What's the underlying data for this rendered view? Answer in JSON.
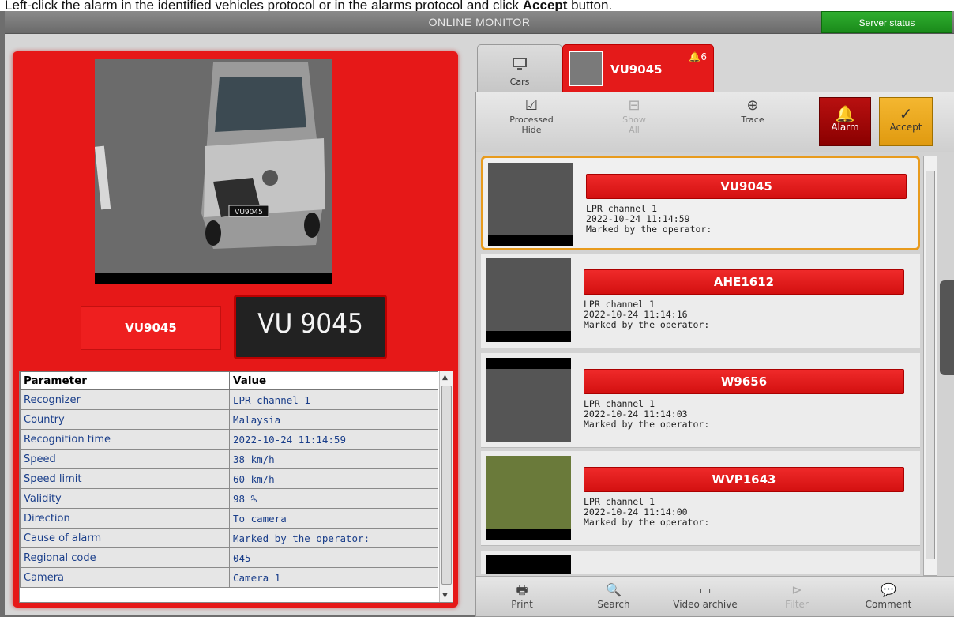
{
  "instruction": {
    "prefix": "Left-click the alarm in the identified vehicles protocol or in the alarms protocol and click ",
    "bold": "Accept",
    "suffix": " button."
  },
  "window": {
    "title": "ONLINE MONITOR",
    "server_status": "Server status"
  },
  "alarm": {
    "plate_text": "VU9045",
    "plate_image_text": "VU 9045",
    "photo_plate_text": "VU9045"
  },
  "params": {
    "col_param": "Parameter",
    "col_value": "Value",
    "rows": [
      {
        "k": "Recognizer",
        "v": "LPR channel  1"
      },
      {
        "k": "Country",
        "v": "Malaysia"
      },
      {
        "k": "Recognition time",
        "v": "2022-10-24 11:14:59"
      },
      {
        "k": "Speed",
        "v": "38 km/h"
      },
      {
        "k": "Speed limit",
        "v": "60 km/h"
      },
      {
        "k": "Validity",
        "v": "98 %"
      },
      {
        "k": "Direction",
        "v": "To camera"
      },
      {
        "k": "Cause of alarm",
        "v": "Marked by the operator:"
      },
      {
        "k": "Regional code",
        "v": "045"
      },
      {
        "k": "Camera",
        "v": "Camera 1"
      }
    ]
  },
  "tabs": {
    "cars": "Cars",
    "active": "VU9045",
    "badge": "6"
  },
  "toolbar": {
    "processed": "Processed",
    "hide": "Hide",
    "show": "Show",
    "all": "All",
    "trace": "Trace",
    "alarm": "Alarm",
    "accept": "Accept"
  },
  "cards": [
    {
      "plate": "VU9045",
      "channel": "LPR channel  1",
      "time": "2022-10-24 11:14:59",
      "marked": "Marked by the operator:"
    },
    {
      "plate": "AHE1612",
      "channel": "LPR channel  1",
      "time": "2022-10-24 11:14:16",
      "marked": "Marked by the operator:"
    },
    {
      "plate": "W9656",
      "channel": "LPR channel  1",
      "time": "2022-10-24 11:14:03",
      "marked": "Marked by the operator:"
    },
    {
      "plate": "WVP1643",
      "channel": "LPR channel  1",
      "time": "2022-10-24 11:14:00",
      "marked": "Marked by the operator:"
    }
  ],
  "bottombar": {
    "print": "Print",
    "search": "Search",
    "video_archive": "Video archive",
    "filter": "Filter",
    "comment": "Comment"
  },
  "colors": {
    "alarm_red": "#e61818",
    "accept_orange": "#f0a820",
    "server_green": "#1f9a1f",
    "selection_orange": "#e89b1d"
  }
}
